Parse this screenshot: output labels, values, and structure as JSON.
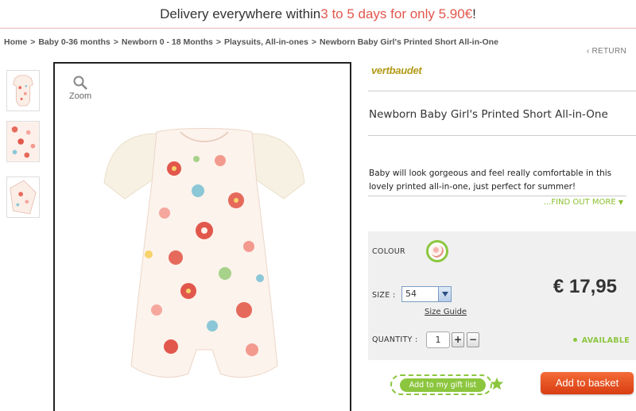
{
  "banner": {
    "prefix": "Delivery everywhere within ",
    "highlight": "3 to 5 days for only 5.90€",
    "suffix": "!"
  },
  "breadcrumb": [
    "Home",
    "Baby 0-36 months",
    "Newborn 0 - 18 Months",
    "Playsuits, All-in-ones",
    "Newborn Baby Girl's Printed Short All-in-One"
  ],
  "breadcrumb_separator": ">",
  "return_label": "RETURN",
  "zoom_label": "Zoom",
  "product": {
    "brand": "vertbaudet",
    "title": "Newborn Baby Girl's Printed Short All-in-One",
    "description": "Baby will look gorgeous and feel really comfortable in this lovely printed all-in-one, just perfect for summer!",
    "find_out_more": "...FIND OUT MORE",
    "price": "€ 17,95"
  },
  "options": {
    "colour_label": "COLOUR",
    "size_label": "SIZE :",
    "size_value": "54",
    "size_guide": "Size Guide",
    "quantity_label": "QUANTITY :",
    "quantity_value": "1",
    "plus": "+",
    "minus": "−",
    "availability": "AVAILABLE"
  },
  "actions": {
    "gift_list": "Add to my gift list",
    "basket": "Add to basket"
  },
  "colors": {
    "accent": "#e2574c",
    "green": "#8cc63f",
    "basket": "#e8501f",
    "brand": "#b29a17"
  }
}
